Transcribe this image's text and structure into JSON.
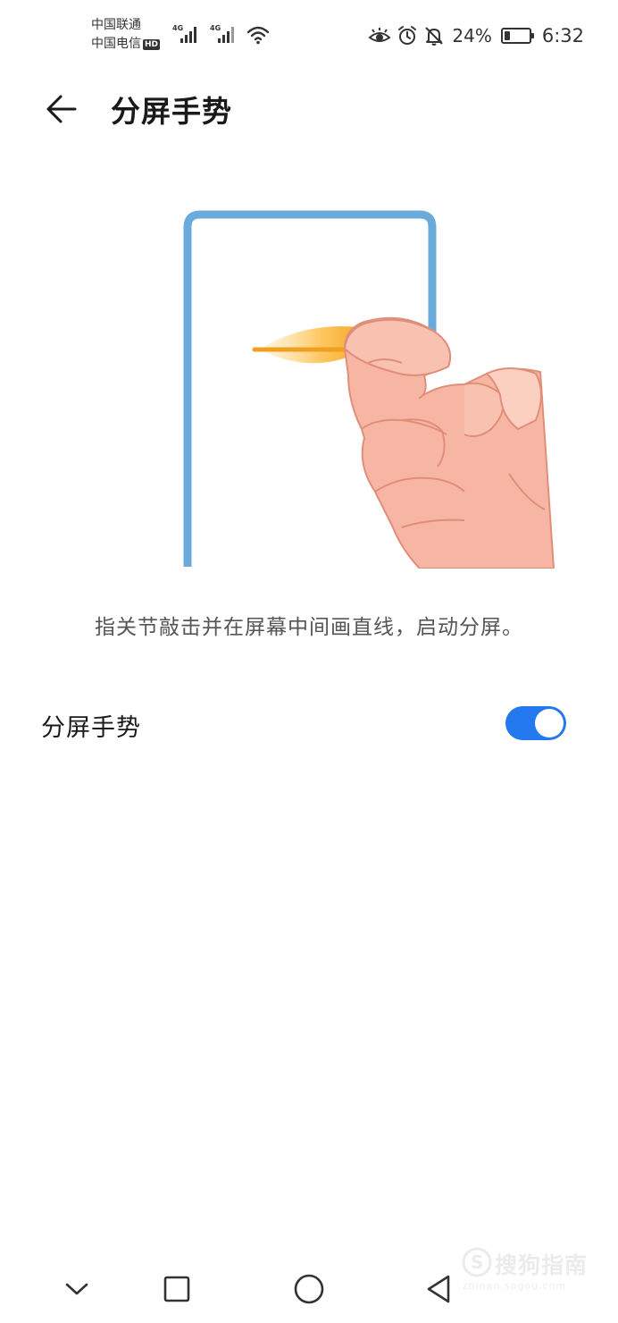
{
  "status_bar": {
    "carrier_1": "中国联通",
    "carrier_2": "中国电信",
    "hd_badge": "HD",
    "network_1": "4G",
    "network_2": "4G",
    "battery_percent": "24%",
    "battery_level": 0.24,
    "time": "6:32",
    "icons": [
      "eye-comfort-icon",
      "alarm-icon",
      "bell-off-icon",
      "wifi-icon",
      "signal-icon"
    ]
  },
  "header": {
    "title": "分屏手势",
    "back_icon": "arrow-left-icon"
  },
  "illustration": {
    "frame_color": "#6aabdc",
    "swipe_color": "#f5a623",
    "hand_color": "#f7b6a3"
  },
  "description": "指关节敲击并在屏幕中间画直线，启动分屏。",
  "setting": {
    "label": "分屏手势",
    "enabled": true,
    "accent_color": "#2479ee"
  },
  "nav_bar": {
    "items": [
      "chevron-down-icon",
      "recent-apps-square-icon",
      "home-circle-icon",
      "back-triangle-icon"
    ]
  },
  "watermark": {
    "text": "搜狗指南",
    "url": "zhinan.sogou.com"
  }
}
